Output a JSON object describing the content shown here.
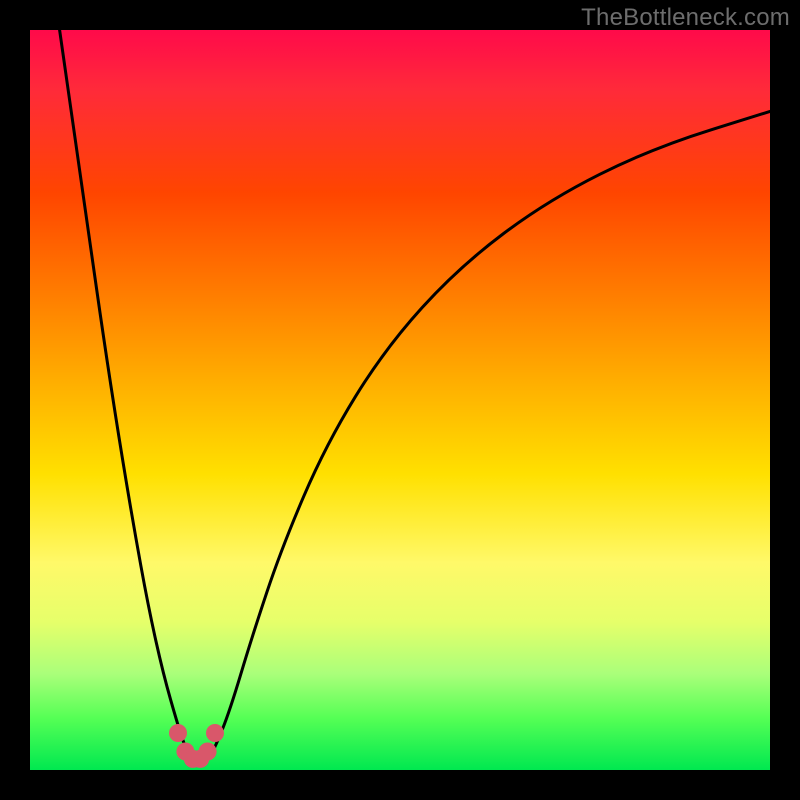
{
  "watermark": "TheBottleneck.com",
  "chart_data": {
    "type": "line",
    "title": "",
    "xlabel": "",
    "ylabel": "",
    "xlim": [
      0,
      100
    ],
    "ylim": [
      0,
      100
    ],
    "series": [
      {
        "name": "bottleneck-curve",
        "x": [
          4,
          6,
          8,
          10,
          12,
          14,
          16,
          18,
          20,
          21,
          22,
          23,
          24,
          25,
          27,
          30,
          34,
          40,
          48,
          58,
          70,
          84,
          100
        ],
        "values": [
          100,
          86,
          72,
          58,
          45,
          33,
          22,
          13,
          6,
          3,
          1.5,
          1,
          1.5,
          3,
          8,
          18,
          30,
          44,
          57,
          68,
          77,
          84,
          89
        ]
      },
      {
        "name": "highlight-dots",
        "x": [
          20,
          21,
          22,
          23,
          24,
          25
        ],
        "values": [
          5,
          2.5,
          1.5,
          1.5,
          2.5,
          5
        ]
      }
    ],
    "colors": {
      "curve": "#000000",
      "dots": "#d9576a"
    }
  }
}
